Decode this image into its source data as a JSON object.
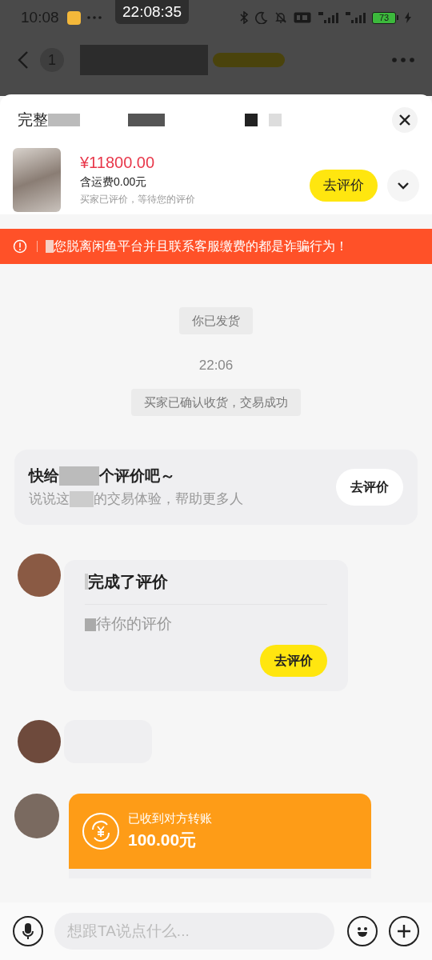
{
  "status_bar": {
    "time": "10:08",
    "clock_overlay": "22:08:35",
    "battery": "73"
  },
  "nav": {
    "badge": "1"
  },
  "sheet": {
    "title": "完整",
    "price": "¥11800.00",
    "shipping": "含运费0.00元",
    "status": "买家已评价，等待您的评价",
    "button": "去评价",
    "expanded": false
  },
  "banner": {
    "text": "您脱离闲鱼平台并且联系客服缴费的都是诈骗行为！"
  },
  "messages": [
    {
      "kind": "system",
      "text": "你已发货"
    },
    {
      "kind": "time",
      "text": "22:06"
    },
    {
      "kind": "system",
      "text": "买家已确认收货，交易成功"
    },
    {
      "kind": "prompt",
      "title_start": "快给",
      "title_end": "个评价吧～",
      "subtitle_start": "说说这",
      "subtitle_end": "的交易体验，帮助更多人",
      "button": "去评价"
    },
    {
      "kind": "review",
      "title": "完成了评价",
      "subtitle": "待你的评价",
      "button": "去评价"
    },
    {
      "kind": "blurred"
    },
    {
      "kind": "transfer",
      "title": "已收到对方转账",
      "amount": "100.00元"
    }
  ],
  "composer": {
    "placeholder": "想跟TA说点什么..."
  }
}
